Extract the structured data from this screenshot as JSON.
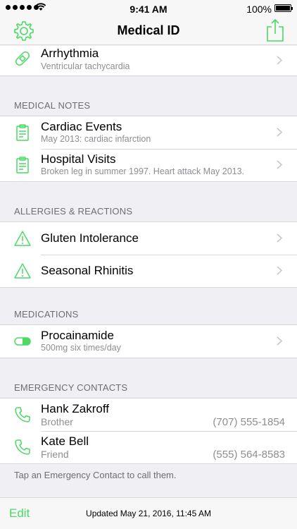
{
  "status": {
    "time": "9:41 AM",
    "battery": "100%"
  },
  "nav": {
    "title": "Medical ID"
  },
  "conditions": [
    {
      "title": "Arrhythmia",
      "subtitle": "Ventricular tachycardia"
    }
  ],
  "notes": {
    "header": "MEDICAL NOTES",
    "items": [
      {
        "title": "Cardiac Events",
        "subtitle": "May 2013: cardiac infarction"
      },
      {
        "title": "Hospital Visits",
        "subtitle": "Broken leg in summer 1997.  Heart attack May 2013."
      }
    ]
  },
  "allergies": {
    "header": "ALLERGIES & REACTIONS",
    "items": [
      {
        "title": "Gluten Intolerance"
      },
      {
        "title": "Seasonal Rhinitis"
      }
    ]
  },
  "medications": {
    "header": "MEDICATIONS",
    "items": [
      {
        "title": "Procainamide",
        "subtitle": "500mg six times/day"
      }
    ]
  },
  "contacts": {
    "header": "EMERGENCY CONTACTS",
    "items": [
      {
        "name": "Hank Zakroff",
        "relation": "Brother",
        "phone": "(707) 555-1854"
      },
      {
        "name": "Kate Bell",
        "relation": "Friend",
        "phone": "(555) 564-8583"
      }
    ],
    "footer": "Tap an Emergency Contact to call them."
  },
  "toolbar": {
    "edit": "Edit",
    "updated": "Updated May 21, 2016, 11:45 AM"
  },
  "colors": {
    "accent": "#4cd964",
    "secondary_text": "#8e8e93",
    "background": "#efeff4"
  },
  "icons": {
    "condition": "bandage-icon",
    "note": "clipboard-icon",
    "allergy": "warning-triangle-icon",
    "medication": "pill-icon",
    "contact": "phone-icon"
  }
}
